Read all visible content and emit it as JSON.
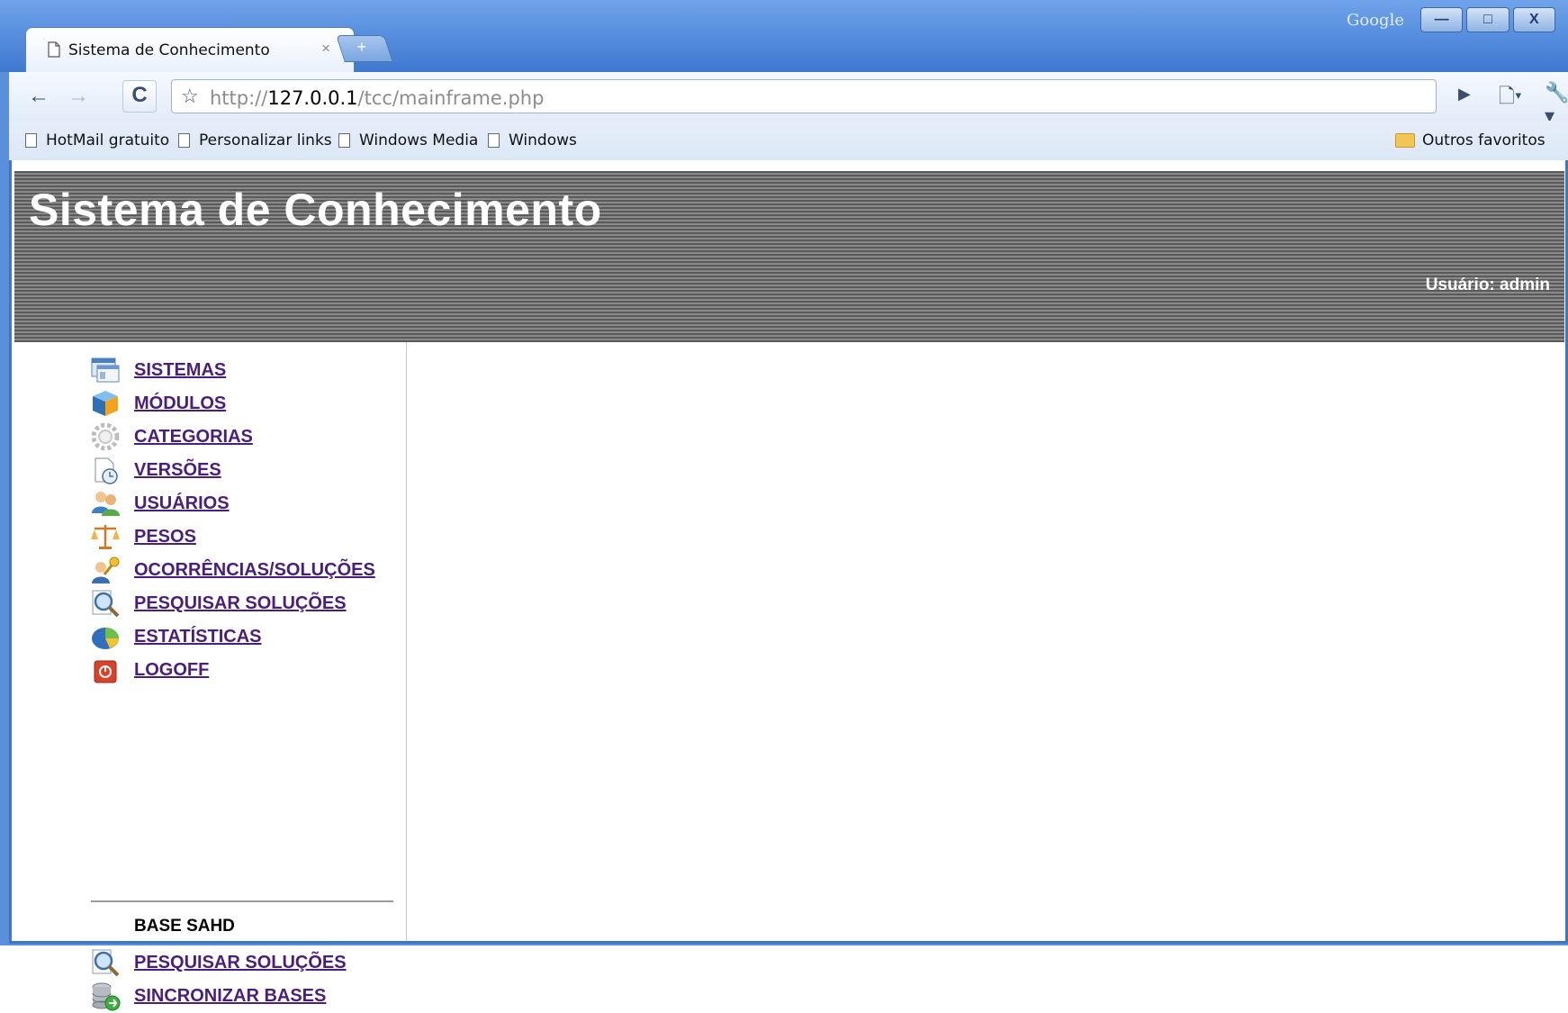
{
  "browser": {
    "tab_title": "Sistema de Conhecimento",
    "tab_close": "×",
    "new_tab": "+",
    "google_label": "Google",
    "window_buttons": {
      "minimize": "—",
      "maximize": "□",
      "close": "X"
    },
    "url_scheme": "http://",
    "url_host": "127.0.0.1",
    "url_path": "/tcc/mainframe.php",
    "bookmarks": [
      "HotMail gratuito",
      "Personalizar links",
      "Windows Media",
      "Windows"
    ],
    "other_bookmarks": "Outros favoritos"
  },
  "header": {
    "title": "Sistema de Conhecimento",
    "user": "Usuário: admin"
  },
  "sidebar": {
    "items": [
      {
        "label": "SISTEMAS",
        "icon": "windows-icon"
      },
      {
        "label": "MÓDULOS",
        "icon": "cube-icon"
      },
      {
        "label": "CATEGORIAS",
        "icon": "gear-icon"
      },
      {
        "label": "VERSÕES",
        "icon": "document-clock-icon"
      },
      {
        "label": "USUÁRIOS",
        "icon": "users-icon"
      },
      {
        "label": "PESOS",
        "icon": "scale-icon"
      },
      {
        "label": "OCORRÊNCIAS/SOLUÇÕES",
        "icon": "user-key-icon"
      },
      {
        "label": "PESQUISAR SOLUÇÕES",
        "icon": "search-icon"
      },
      {
        "label": "ESTATÍSTICAS",
        "icon": "pie-chart-icon"
      },
      {
        "label": "LOGOFF",
        "icon": "power-icon"
      }
    ],
    "section_label": "BASE SAHD",
    "base_items": [
      {
        "label": "PESQUISAR SOLUÇÕES",
        "icon": "search-icon"
      },
      {
        "label": "SINCRONIZAR BASES",
        "icon": "database-sync-icon"
      }
    ]
  },
  "colors": {
    "link": "#4a1f7a",
    "banner_stripe_dark": "#5a5a5a",
    "banner_stripe_light": "#8a8a8a",
    "chrome_blue": "#3f74c9"
  }
}
